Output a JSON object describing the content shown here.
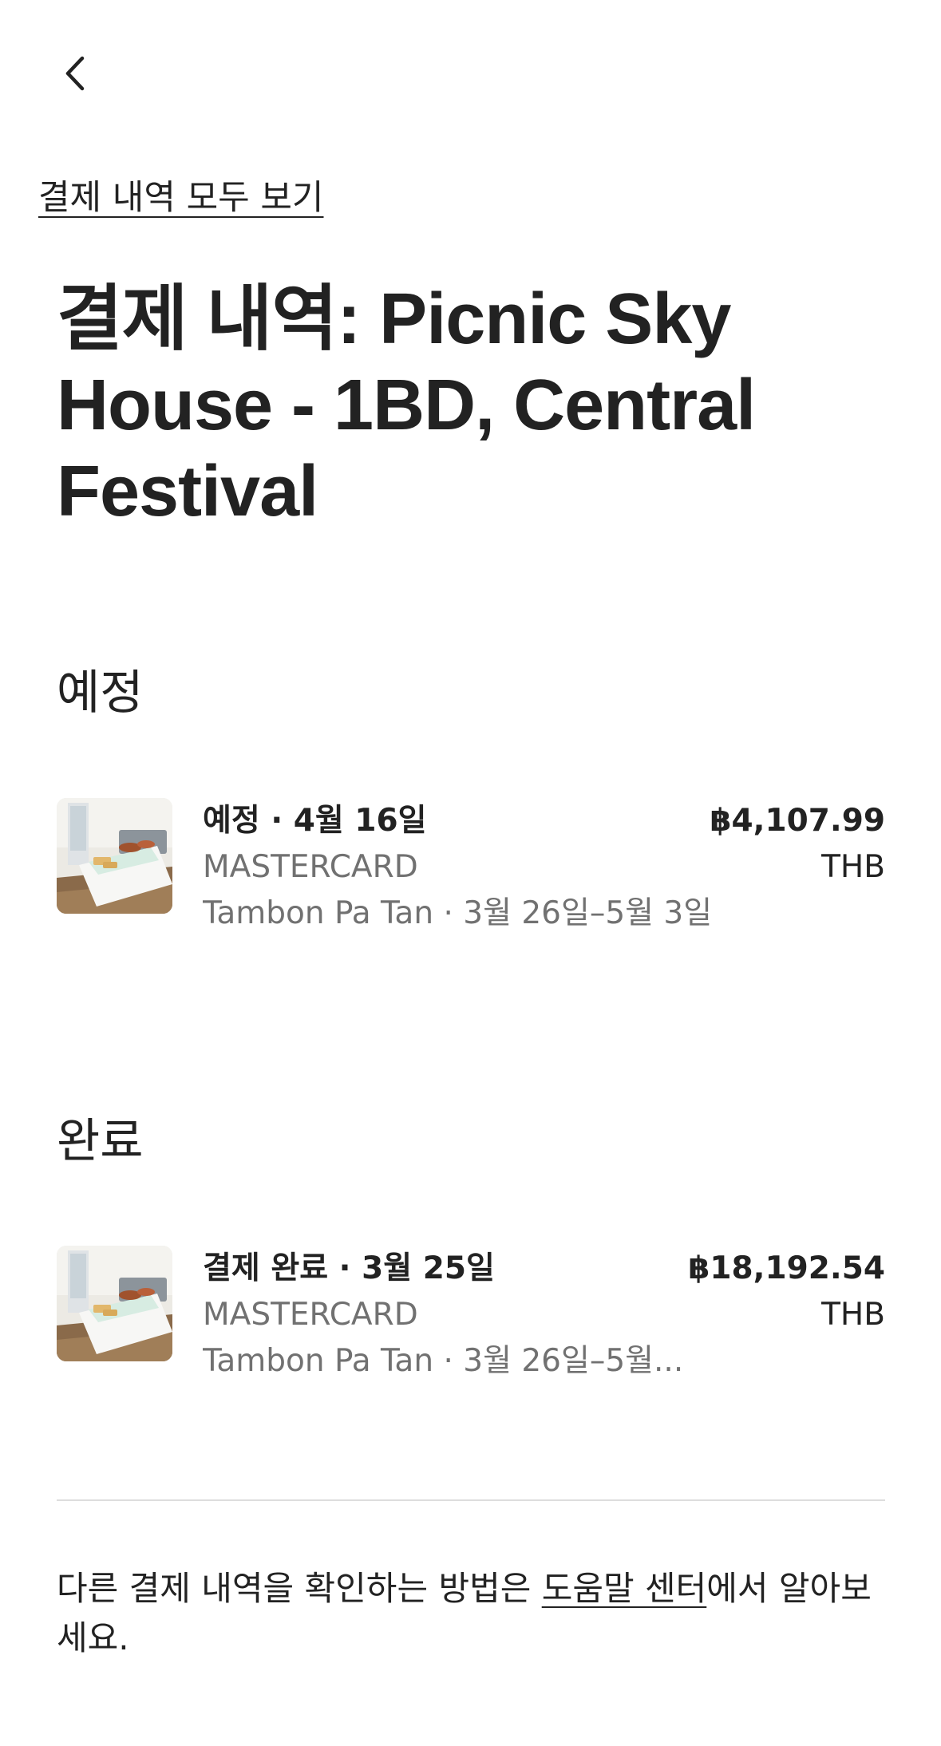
{
  "header": {
    "back_icon": "chevron-left-icon",
    "view_all_label": "결제 내역 모두 보기"
  },
  "page_title": "결제 내역: Picnic Sky House - 1BD, Central Festival",
  "sections": [
    {
      "title": "예정",
      "payments": [
        {
          "thumbnail": "bedroom-photo",
          "status": "예정",
          "date": "4월 16일",
          "card": "MASTERCARD",
          "location": "Tambon Pa Tan",
          "stay": "3월 26일–5월 3일",
          "amount": "฿4,107.99",
          "currency": "THB"
        }
      ]
    },
    {
      "title": "완료",
      "payments": [
        {
          "thumbnail": "bedroom-photo",
          "status": "결제 완료",
          "date": "3월 25일",
          "card": "MASTERCARD",
          "location": "Tambon Pa Tan",
          "stay": "3월 26일–5월...",
          "amount": "฿18,192.54",
          "currency": "THB"
        }
      ]
    }
  ],
  "footer": {
    "help_prefix": "다른 결제 내역을 확인하는 방법은 ",
    "help_link": "도움말 센터",
    "help_suffix": "에서 알아보세요."
  },
  "colors": {
    "text_primary": "#222222",
    "text_secondary": "#717171",
    "divider": "#dddddd",
    "background": "#ffffff"
  }
}
